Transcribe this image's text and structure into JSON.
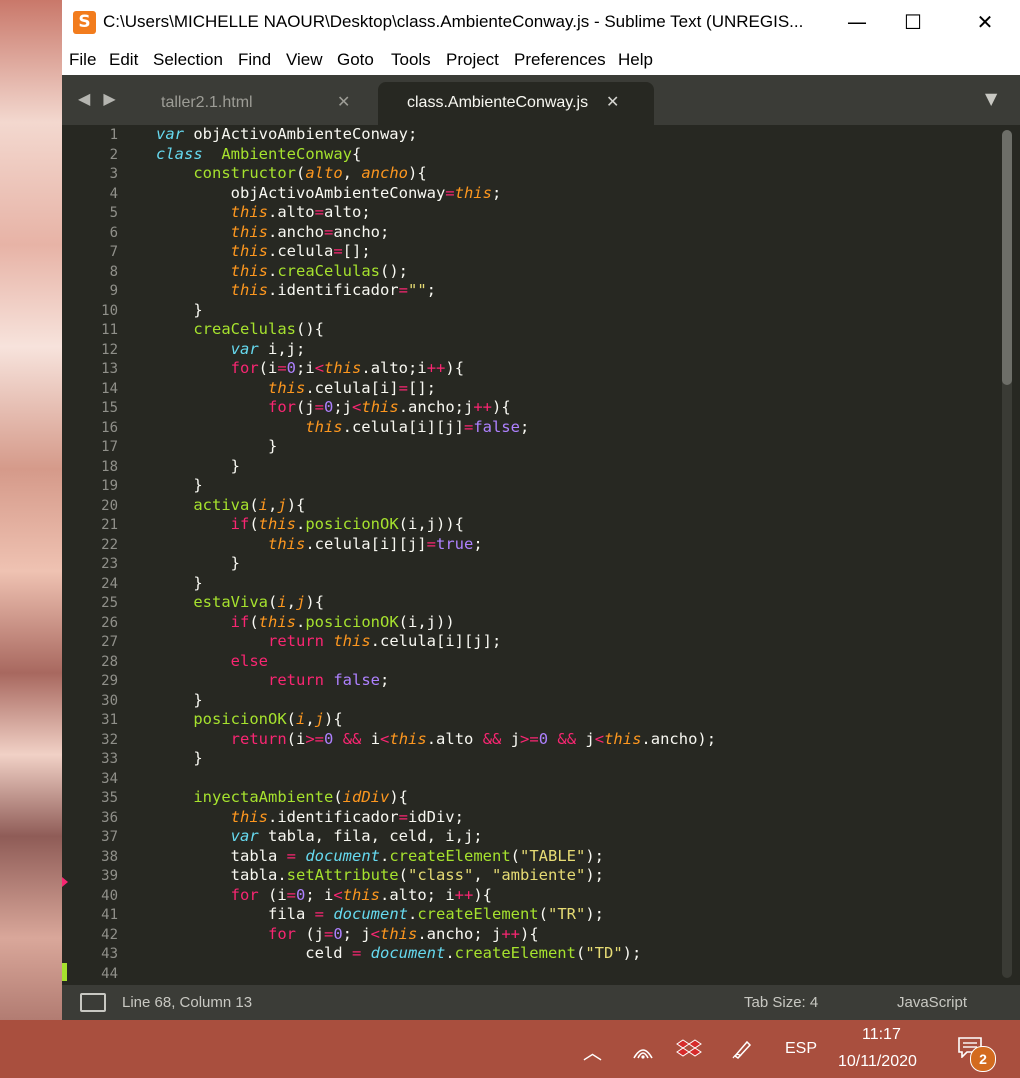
{
  "window": {
    "title": "C:\\Users\\MICHELLE NAOUR\\Desktop\\class.AmbienteConway.js - Sublime Text (UNREGIS...",
    "app_icon": "S",
    "minimize_icon": "—",
    "maximize_icon": "☐",
    "close_icon": "✕"
  },
  "menu": [
    "File",
    "Edit",
    "Selection",
    "Find",
    "View",
    "Goto",
    "Tools",
    "Project",
    "Preferences",
    "Help"
  ],
  "tabs": [
    {
      "label": "taller2.1.html",
      "active": false
    },
    {
      "label": "class.AmbienteConway.js",
      "active": true
    }
  ],
  "tab_close_icon": "✕",
  "tab_nav_arrows": "◀ ▶",
  "tab_dropdown_icon": "▼",
  "code_lines": [
    "1",
    "2",
    "3",
    "4",
    "5",
    "6",
    "7",
    "8",
    "9",
    "10",
    "11",
    "12",
    "13",
    "14",
    "15",
    "16",
    "17",
    "18",
    "19",
    "20",
    "21",
    "22",
    "23",
    "24",
    "25",
    "26",
    "27",
    "28",
    "29",
    "30",
    "31",
    "32",
    "33",
    "34",
    "35",
    "36",
    "37",
    "38",
    "39",
    "40",
    "41",
    "42",
    "43",
    "44"
  ],
  "status": {
    "position": "Line 68, Column 13",
    "tab_size": "Tab Size: 4",
    "syntax": "JavaScript"
  },
  "taskbar": {
    "chevron_icon": "︿",
    "wifi_icon": "wifi-icon",
    "dropbox_icon": "dropbox-icon",
    "pen_icon": "pen-icon",
    "language": "ESP",
    "time": "11:17",
    "date": "10/11/2020",
    "notification_count": "2"
  },
  "colors": {
    "editor_bg": "#272822",
    "keyword": "#66d9ef",
    "operator": "#f92672",
    "function": "#a6e22e",
    "string": "#e6db74",
    "number": "#ae81ff",
    "parameter": "#fd971f"
  }
}
